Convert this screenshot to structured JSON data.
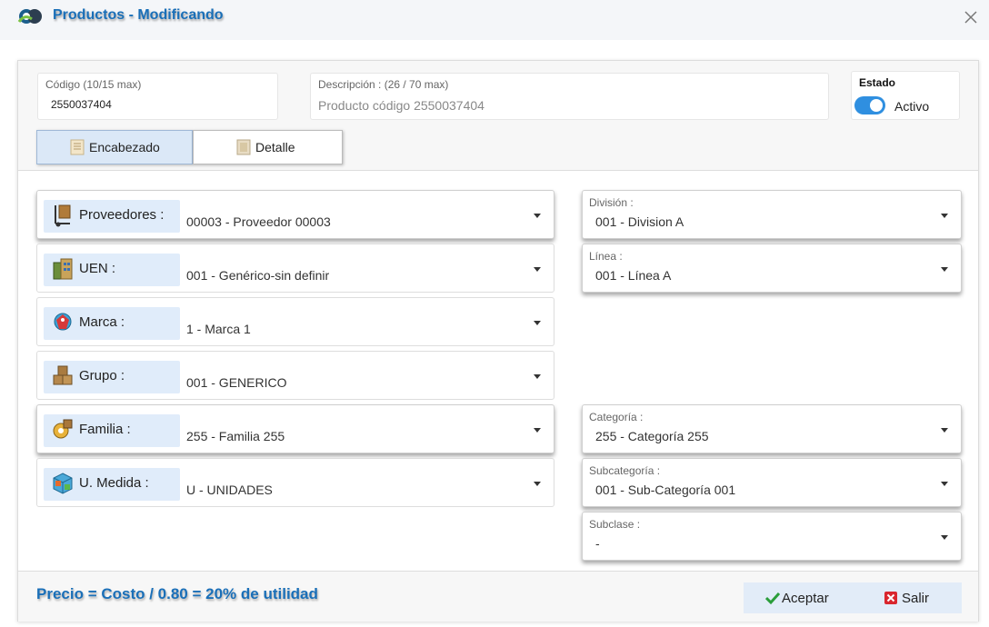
{
  "window": {
    "title": "Productos - Modificando",
    "close_icon": "close-icon"
  },
  "header": {
    "codigo": {
      "label": "Código (10/15 max)",
      "value": "2550037404"
    },
    "descripcion": {
      "label": "Descripción : (26 / 70 max)",
      "placeholder": "Producto código 2550037404"
    },
    "estado": {
      "label": "Estado",
      "toggle_label": "Activo",
      "on": true
    }
  },
  "tabs": [
    {
      "label": "Encabezado",
      "active": true,
      "icon": "document-icon"
    },
    {
      "label": "Detalle",
      "active": false,
      "icon": "document-icon"
    }
  ],
  "left_selects": [
    {
      "label": "Proveedores :",
      "value": "00003 - Proveedor 00003",
      "icon": "hand-truck-icon"
    },
    {
      "label": "UEN :",
      "value": "001 - Genérico-sin definir",
      "icon": "building-icon"
    },
    {
      "label": "Marca :",
      "value": "1 - Marca 1",
      "icon": "tag-globe-icon"
    },
    {
      "label": "Grupo :",
      "value": "001 - GENERICO",
      "icon": "boxes-icon"
    },
    {
      "label": "Familia :",
      "value": "255 - Familia 255",
      "icon": "gear-box-icon"
    },
    {
      "label": "U. Medida :",
      "value": "U - UNIDADES",
      "icon": "cube-icon"
    }
  ],
  "right_selects": [
    {
      "label": "División :",
      "value": "001 - Division A"
    },
    {
      "label": "Línea :",
      "value": "001 - Línea A"
    },
    {
      "label": "Categoría :",
      "value": "255 - Categoría 255"
    },
    {
      "label": "Subcategoría :",
      "value": "001 - Sub-Categoría 001"
    },
    {
      "label": "Subclase :",
      "value": "-"
    }
  ],
  "footer": {
    "formula": "Precio = Costo / 0.80 = 20% de utilidad",
    "accept_label": "Aceptar",
    "exit_label": "Salir"
  },
  "colors": {
    "accent": "#1a6fb8",
    "toggle_on": "#2f8fe0",
    "label_bg": "#e0ecfa",
    "accept_icon": "#2a9d3a",
    "exit_icon": "#d9262e"
  }
}
